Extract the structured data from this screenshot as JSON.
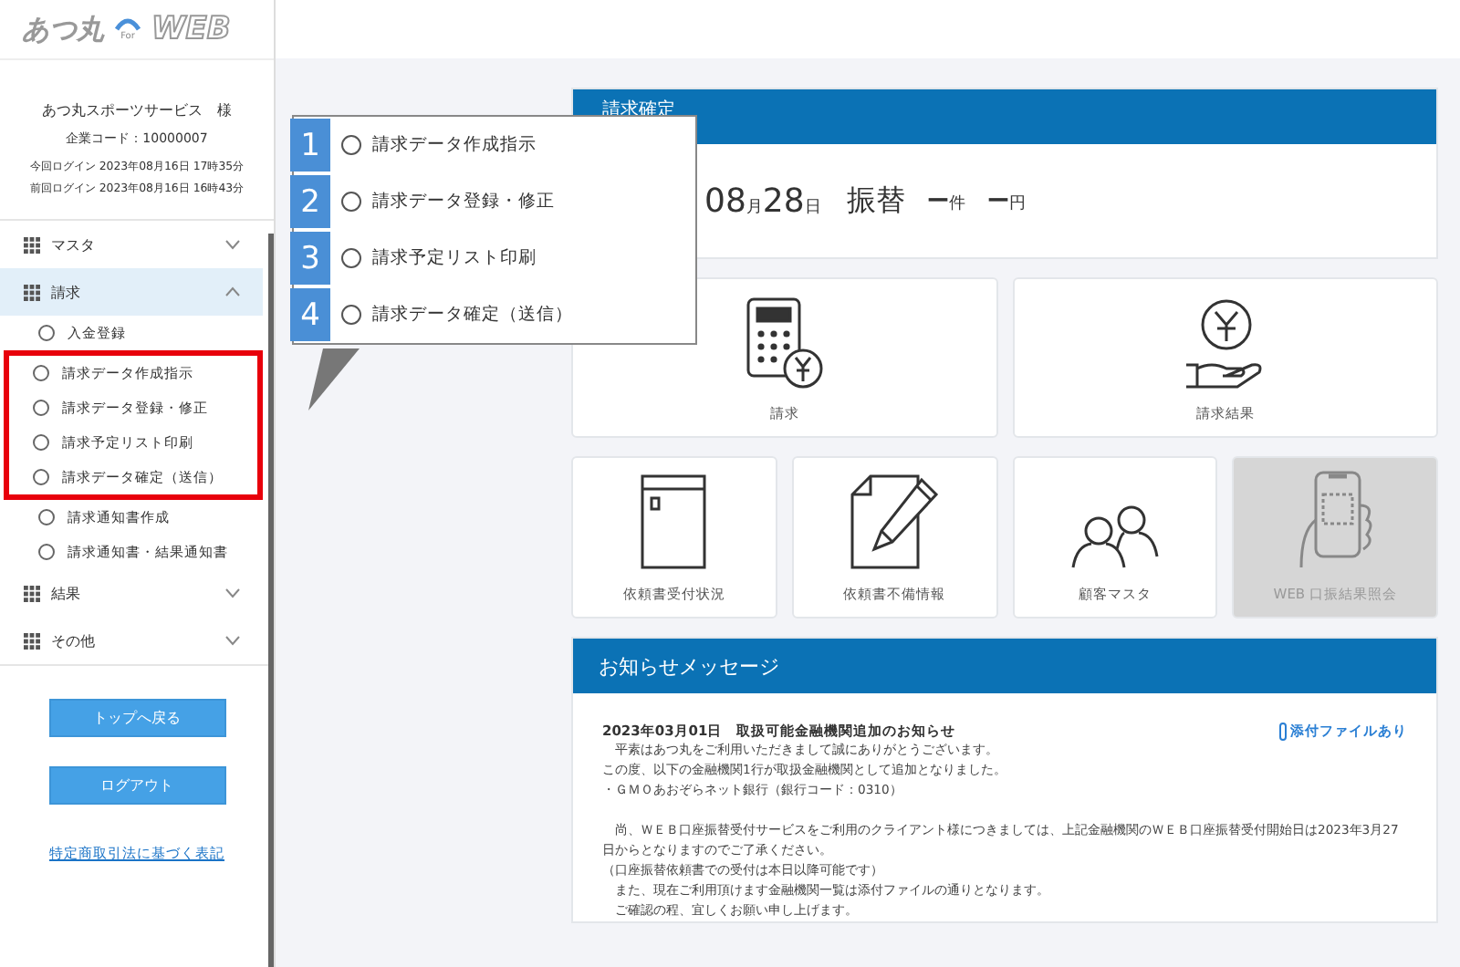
{
  "logo": {
    "brand": "あつ丸",
    "sub": "For",
    "web": "WEB"
  },
  "user": {
    "name": "あつ丸スポーツサービス　様",
    "company_code": "企業コード：10000007",
    "login_now": "今回ログイン 2023年08月16日 17時35分",
    "login_prev": "前回ログイン 2023年08月16日 16時43分"
  },
  "menu": [
    {
      "label": "マスタ",
      "expanded": false,
      "selected": false
    },
    {
      "label": "請求",
      "expanded": true,
      "selected": true,
      "children": [
        {
          "label": "入金登録",
          "highlighted": false
        },
        {
          "label": "請求データ作成指示",
          "highlighted": true
        },
        {
          "label": "請求データ登録・修正",
          "highlighted": true
        },
        {
          "label": "請求予定リスト印刷",
          "highlighted": true
        },
        {
          "label": "請求データ確定（送信）",
          "highlighted": true
        },
        {
          "label": "請求通知書作成",
          "highlighted": false
        },
        {
          "label": "請求通知書・結果通知書",
          "highlighted": false
        }
      ]
    },
    {
      "label": "結果",
      "expanded": false,
      "selected": false
    },
    {
      "label": "その他",
      "expanded": false,
      "selected": false
    }
  ],
  "buttons": [
    "トップへ戻る",
    "ログアウト"
  ],
  "legal_link": "特定商取引法に基づく表記",
  "callout": [
    {
      "number": "1",
      "label": "請求データ作成指示"
    },
    {
      "number": "2",
      "label": "請求データ登録・修正"
    },
    {
      "number": "3",
      "label": "請求予定リスト印刷"
    },
    {
      "number": "4",
      "label": "請求データ確定（送信）"
    }
  ],
  "billing": {
    "title": "請求確定",
    "date_month": "08",
    "month_unit": "月",
    "day": "28",
    "day_unit": "日",
    "method": "振替",
    "count": "ー",
    "count_unit": "件",
    "amount": "ー",
    "amount_unit": "円"
  },
  "tiles_large": [
    {
      "label": "請求",
      "kind": "calculator",
      "disabled": false
    },
    {
      "label": "請求結果",
      "kind": "coin-hand",
      "disabled": false
    }
  ],
  "tiles_small": [
    {
      "label": "依頼書受付状況",
      "kind": "envelope",
      "disabled": false
    },
    {
      "label": "依頼書不備情報",
      "kind": "document",
      "disabled": false
    },
    {
      "label": "顧客マスタ",
      "kind": "people",
      "disabled": false
    },
    {
      "label": "WEB 口振結果照会",
      "kind": "phone",
      "disabled": true
    }
  ],
  "notice": {
    "title": "お知らせメッセージ",
    "heading": "2023年03月01日　取扱可能金融機関追加のお知らせ",
    "attachment": "添付ファイルあり",
    "paragraphs": [
      [
        "　平素はあつ丸をご利用いただきまして誠にありがとうございます。",
        "この度、以下の金融機関1行が取扱金融機関として追加となりました。",
        "・ＧＭＯあおぞらネット銀行（銀行コード：0310）"
      ],
      [
        "　尚、ＷＥＢ口座振替受付サービスをご利用のクライアント様につきましては、上記金融機関のＷＥＢ口座振替受付開始日は2023年3月27日からとなりますのでご了承ください。",
        "（口座振替依頼書での受付は本日以降可能です）",
        "　また、現在ご利用頂けます金融機関一覧は添付ファイルの通りとなります。",
        "　ご確認の程、宜しくお願い申し上げます。"
      ]
    ]
  }
}
